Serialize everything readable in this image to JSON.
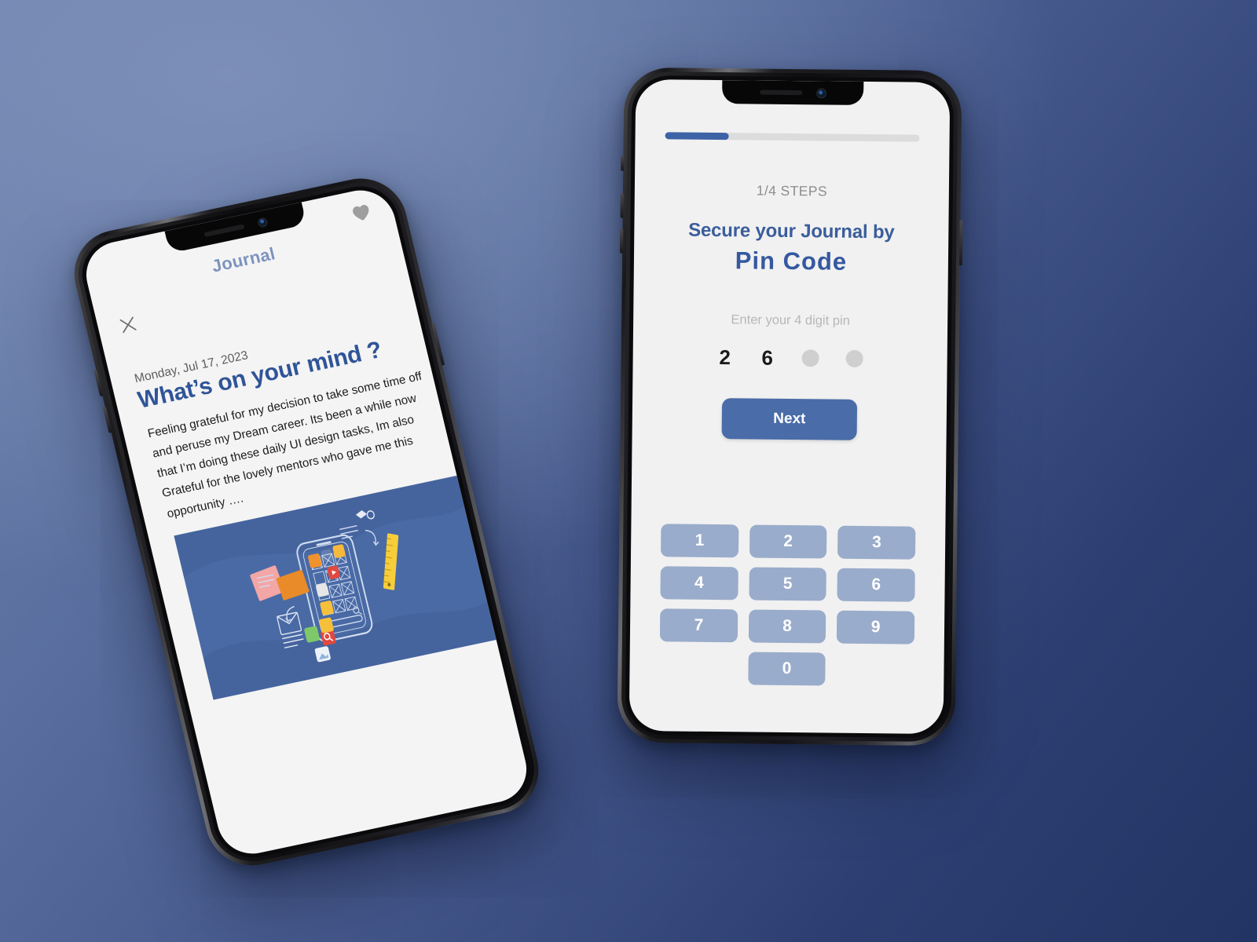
{
  "background": {
    "gradient_from": "#6d81ad",
    "gradient_to": "#223463"
  },
  "theme": {
    "brand_blue": "#3558a0",
    "accent_blue": "#4a6ca8",
    "key_blue": "#9aaccb",
    "muted_gray": "#8d8d8d",
    "title_blue": "#7d93bf"
  },
  "pin_phone": {
    "name": "Pin Code onboarding screen",
    "progress": {
      "percent": 25,
      "value_label": "1/4"
    },
    "steps_label": "1/4 STEPS",
    "heading_line1": "Secure your Journal by",
    "heading_line2": "Pin Code",
    "hint": "Enter your 4 digit pin",
    "pin_entry": {
      "length": 4,
      "entered": [
        "2",
        "6"
      ],
      "empty_slots": 2
    },
    "next_label": "Next",
    "keypad": [
      "1",
      "2",
      "3",
      "4",
      "5",
      "6",
      "7",
      "8",
      "9",
      "0"
    ],
    "icons": {
      "notch_speaker": "speaker-grille-icon",
      "notch_camera": "front-camera-icon"
    }
  },
  "journal_phone": {
    "name": "Journal entry screen",
    "title": "Journal",
    "close_glyph": "✕",
    "favorite_glyph": "♥",
    "date": "Monday, Jul 17, 2023",
    "question": "What’s on your mind ?",
    "body": "Feeling grateful for my decision to take some time off and peruse my Dream career. Its been a while now that I’m doing these daily UI design tasks, Im also Grateful for the lovely  mentors who gave me this opportunity ….",
    "illustration": {
      "alt": "ui-design-illustration",
      "background": "#4a6aa5"
    },
    "icons": {
      "close": "close-icon",
      "favorite": "heart-icon",
      "notch_speaker": "speaker-grille-icon",
      "notch_camera": "front-camera-icon"
    }
  }
}
